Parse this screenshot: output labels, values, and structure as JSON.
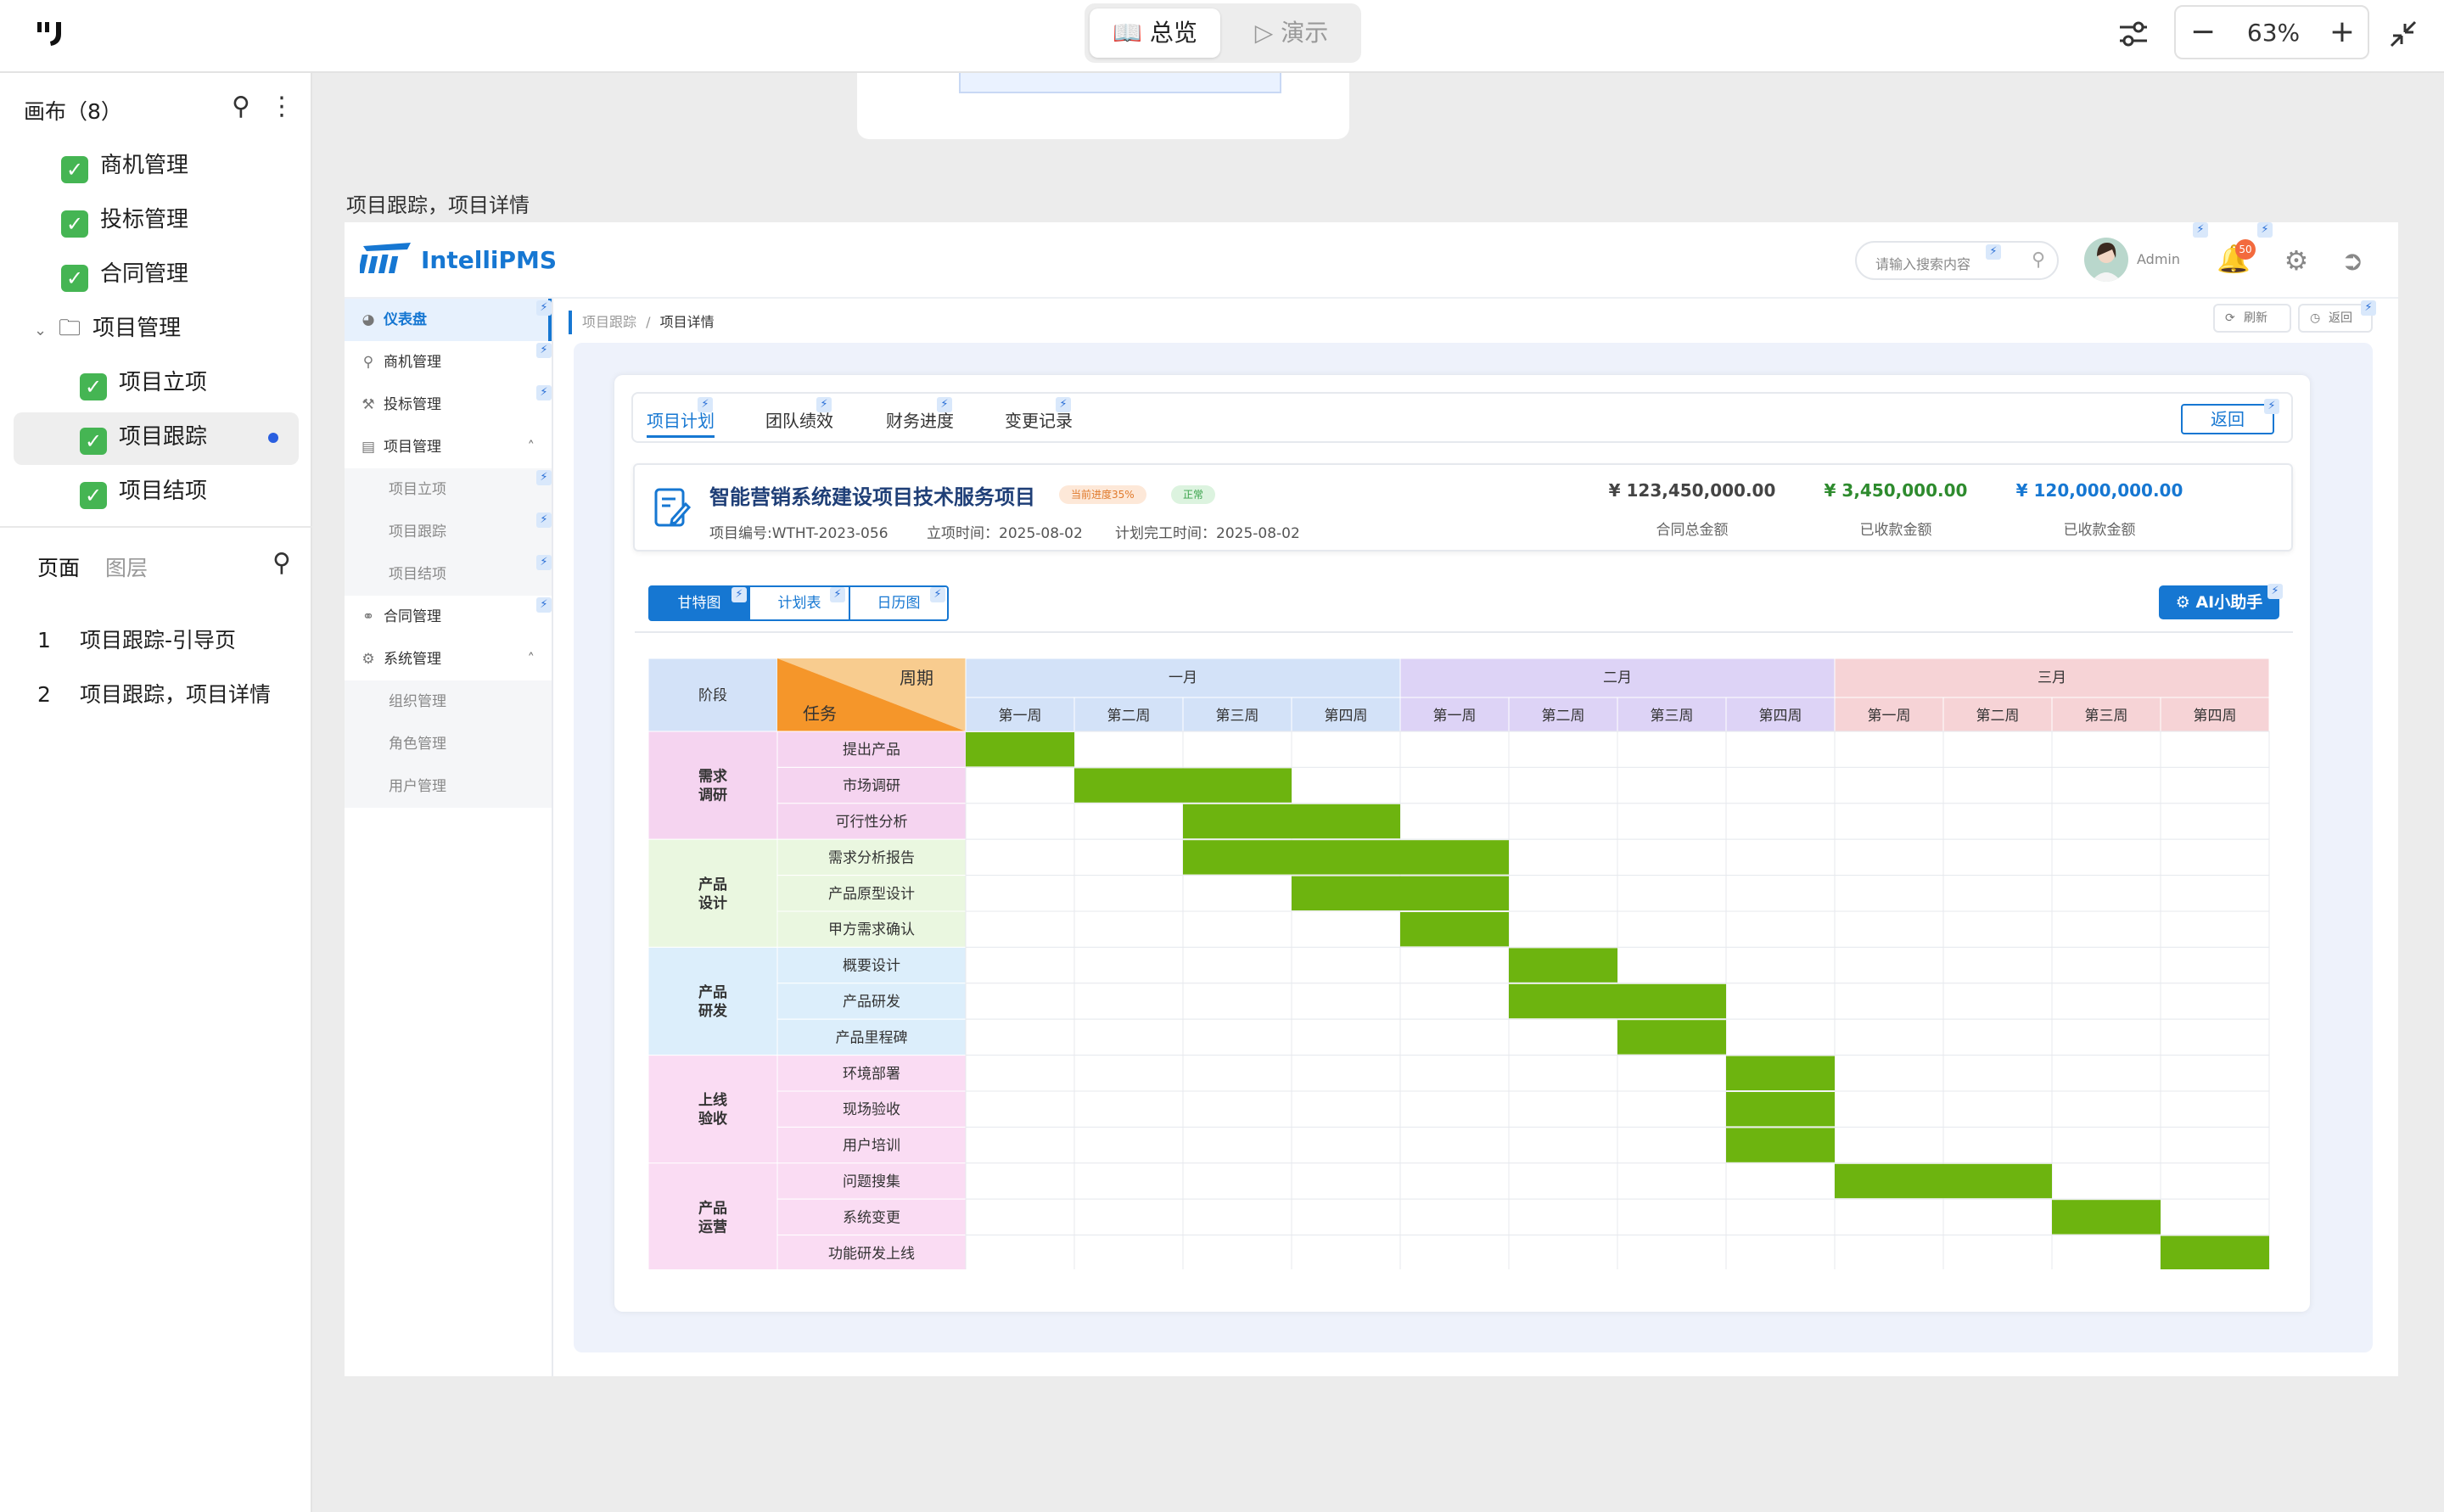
{
  "topbar": {
    "logo": "ꟷ",
    "mode_overview": "总览",
    "mode_present": "演示",
    "zoom": "63%",
    "zoom_out": "−",
    "zoom_in": "+"
  },
  "left_panel": {
    "canvas_title": "画布（8）",
    "tree": [
      {
        "label": "商机管理",
        "type": "check"
      },
      {
        "label": "投标管理",
        "type": "check"
      },
      {
        "label": "合同管理",
        "type": "check"
      },
      {
        "label": "项目管理",
        "type": "folder"
      },
      {
        "label": "项目立项",
        "type": "check"
      },
      {
        "label": "项目跟踪",
        "type": "check",
        "selected": true
      },
      {
        "label": "项目结项",
        "type": "check"
      }
    ],
    "tab_pages": "页面",
    "tab_layers": "图层",
    "pages": [
      {
        "num": "1",
        "label": "项目跟踪-引导页"
      },
      {
        "num": "2",
        "label": "项目跟踪，项目详情"
      }
    ]
  },
  "canvas": {
    "frame_label": "项目跟踪，项目详情"
  },
  "app": {
    "title": "IntelliPMS",
    "search_placeholder": "请输入搜索内容",
    "user": "Admin",
    "notifications": "50",
    "nav": [
      {
        "label": "仪表盘",
        "icon": "dashboard-icon",
        "active": true
      },
      {
        "label": "商机管理",
        "icon": "location-icon"
      },
      {
        "label": "投标管理",
        "icon": "hammer-icon"
      },
      {
        "label": "项目管理",
        "icon": "project-icon",
        "expanded": true
      },
      {
        "label": "项目立项",
        "sub": true
      },
      {
        "label": "项目跟踪",
        "sub": true
      },
      {
        "label": "项目结项",
        "sub": true
      },
      {
        "label": "合同管理",
        "icon": "handshake-icon"
      },
      {
        "label": "系统管理",
        "icon": "gear-icon",
        "expanded": true
      },
      {
        "label": "组织管理",
        "sub": true
      },
      {
        "label": "角色管理",
        "sub": true
      },
      {
        "label": "用户管理",
        "sub": true
      }
    ],
    "breadcrumb": {
      "parent": "项目跟踪",
      "sep": "/",
      "current": "项目详情"
    },
    "refresh": "刷新",
    "back_small": "返回",
    "tabs": [
      "项目计划",
      "团队绩效",
      "财务进度",
      "变更记录"
    ],
    "back": "返回",
    "project": {
      "title": "智能营销系统建设项目技术服务项目",
      "progress_tag": "当前进度35%",
      "status_tag": "正常",
      "code": "项目编号:WTHT-2023-056",
      "start": "立项时间：2025-08-02",
      "end": "计划完工时间：2025-08-02",
      "amounts": [
        {
          "value": "¥ 123,450,000.00",
          "label": "合同总金额",
          "color": "#444444"
        },
        {
          "value": "¥ 3,450,000.00",
          "label": "已收款金额",
          "color": "#2e8b2e"
        },
        {
          "value": "¥ 120,000,000.00",
          "label": "已收款金额",
          "color": "#1677d2"
        }
      ]
    },
    "view_tabs": [
      "甘特图",
      "计划表",
      "日历图"
    ],
    "ai_button": "AI小助手"
  },
  "gantt": {
    "corner_stage": "阶段",
    "corner_period": "周期",
    "corner_task": "任务",
    "months": [
      {
        "label": "一月",
        "color": "#d3e2f8"
      },
      {
        "label": "二月",
        "color": "#ddd3f6"
      },
      {
        "label": "三月",
        "color": "#f6d3d6"
      }
    ],
    "weeks": [
      "第一周",
      "第二周",
      "第三周",
      "第四周"
    ],
    "bar_color": "#6db40f",
    "stages": [
      {
        "label": "需求\n调研",
        "color": "#f5d4f0",
        "tasks": [
          {
            "name": "提出产品",
            "weeks": [
              0
            ]
          },
          {
            "name": "市场调研",
            "weeks": [
              1,
              2
            ]
          },
          {
            "name": "可行性分析",
            "weeks": [
              2,
              3
            ]
          }
        ]
      },
      {
        "label": "产品\n设计",
        "color": "#eaf7e0",
        "tasks": [
          {
            "name": "需求分析报告",
            "weeks": [
              2,
              3,
              4
            ]
          },
          {
            "name": "产品原型设计",
            "weeks": [
              3,
              4
            ]
          },
          {
            "name": "甲方需求确认",
            "weeks": [
              4
            ]
          }
        ]
      },
      {
        "label": "产品\n研发",
        "color": "#dceefb",
        "tasks": [
          {
            "name": "概要设计",
            "weeks": [
              5
            ]
          },
          {
            "name": "产品研发",
            "weeks": [
              5,
              6
            ]
          },
          {
            "name": "产品里程碑",
            "weeks": [
              6
            ]
          }
        ]
      },
      {
        "label": "上线\n验收",
        "color": "#fadcf3",
        "tasks": [
          {
            "name": "环境部署",
            "weeks": [
              7
            ]
          },
          {
            "name": "现场验收",
            "weeks": [
              7
            ]
          },
          {
            "name": "用户培训",
            "weeks": [
              7
            ]
          }
        ]
      },
      {
        "label": "产品\n运营",
        "color": "#fadcf3",
        "tasks": [
          {
            "name": "问题搜集",
            "weeks": [
              8,
              9
            ]
          },
          {
            "name": "系统变更",
            "weeks": [
              10
            ]
          },
          {
            "name": "功能研发上线",
            "weeks": [
              11
            ]
          }
        ]
      }
    ]
  }
}
